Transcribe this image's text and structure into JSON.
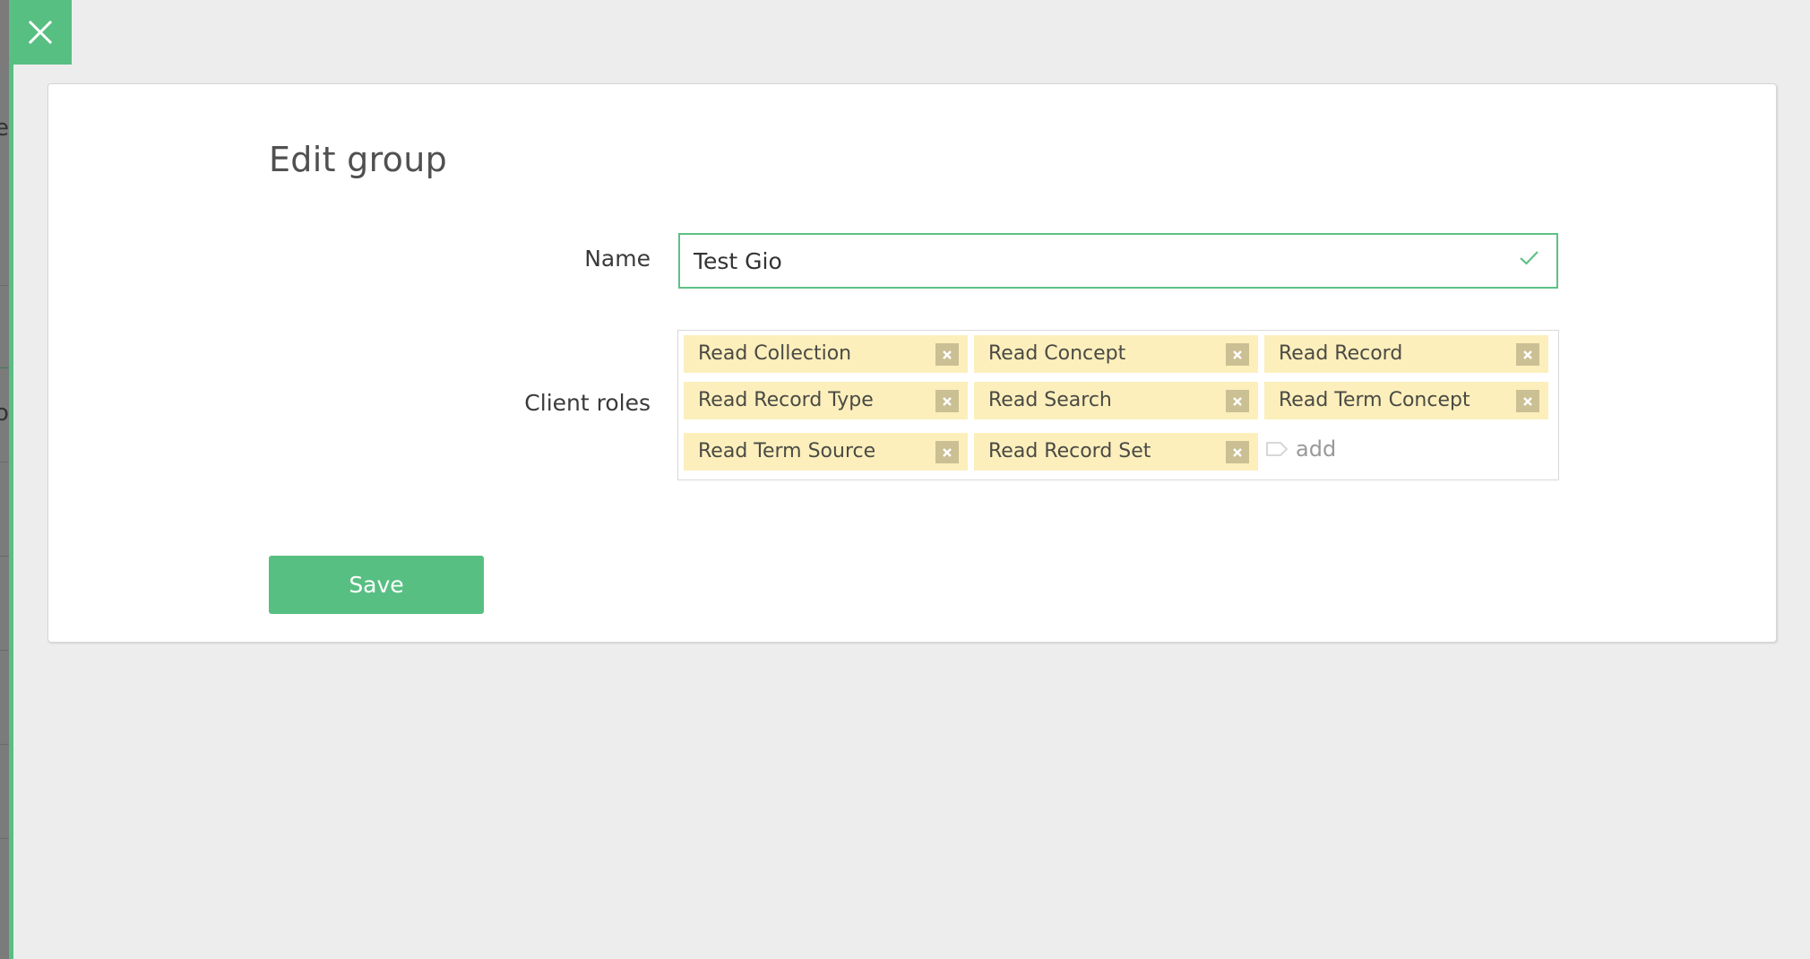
{
  "background": {
    "partial_glyphs": [
      "e",
      "o"
    ]
  },
  "close_button": {
    "icon": "close-icon",
    "color": "#58bf82"
  },
  "dialog": {
    "title": "Edit group",
    "name_field": {
      "label": "Name",
      "value": "Test Gio",
      "status_icon": "checkmark-icon",
      "valid": true
    },
    "client_roles": {
      "label": "Client roles",
      "tags": [
        {
          "label": "Read Collection"
        },
        {
          "label": "Read Concept"
        },
        {
          "label": "Read Record"
        },
        {
          "label": "Read Record Type"
        },
        {
          "label": "Read Search"
        },
        {
          "label": "Read Term Concept"
        },
        {
          "label": "Read Term Source"
        },
        {
          "label": "Read Record Set"
        }
      ],
      "add_placeholder": "add",
      "add_icon": "tag-icon"
    },
    "save_label": "Save"
  },
  "colors": {
    "accent": "#58bf82",
    "tag_bg": "#fcefbc",
    "tag_remove_bg": "#cbbf94",
    "page_bg": "#ededed"
  }
}
